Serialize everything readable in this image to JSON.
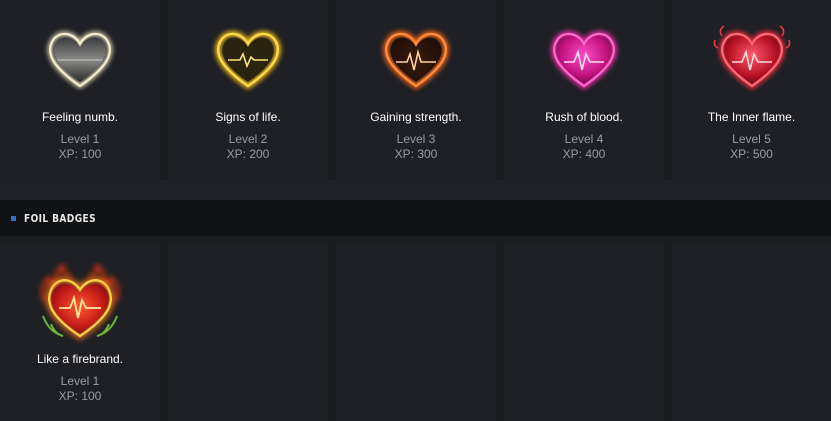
{
  "section": {
    "title": "FOIL BADGES"
  },
  "badges": [
    {
      "name": "Feeling numb.",
      "level": "Level 1",
      "xp": "XP: 100",
      "icon": "heart-badge-white-icon",
      "color": "#f1e7c6"
    },
    {
      "name": "Signs of life.",
      "level": "Level 2",
      "xp": "XP: 200",
      "icon": "heart-badge-gold-icon",
      "color": "#f6c62a"
    },
    {
      "name": "Gaining strength.",
      "level": "Level 3",
      "xp": "XP: 300",
      "icon": "heart-badge-orange-icon",
      "color": "#f07a2e"
    },
    {
      "name": "Rush of blood.",
      "level": "Level 4",
      "xp": "XP: 400",
      "icon": "heart-badge-pink-icon",
      "color": "#ff2fae"
    },
    {
      "name": "The Inner flame.",
      "level": "Level 5",
      "xp": "XP: 500",
      "icon": "heart-badge-red-icon",
      "color": "#ff3b4a"
    }
  ],
  "foil_badges": [
    {
      "name": "Like a firebrand.",
      "level": "Level 1",
      "xp": "XP: 100",
      "icon": "heart-badge-flame-icon",
      "color": "#ff4a1f"
    }
  ]
}
